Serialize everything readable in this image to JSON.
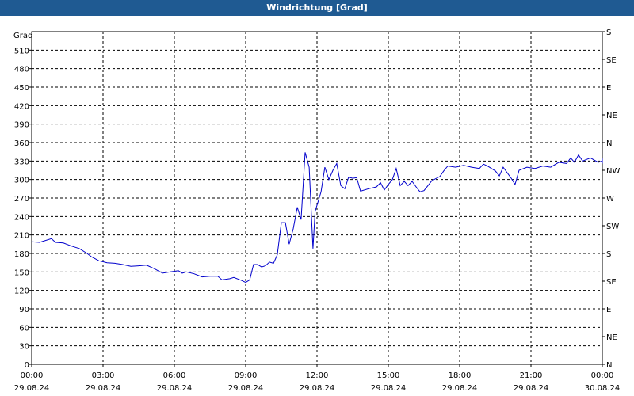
{
  "title": "Windrichtung [Grad]",
  "chart_data": {
    "type": "line",
    "title": "Windrichtung [Grad]",
    "ylabel": "Grad",
    "ylim": [
      0,
      540
    ],
    "xlim_hours": [
      0,
      24
    ],
    "yticks": [
      0,
      30,
      60,
      90,
      120,
      150,
      180,
      210,
      240,
      270,
      300,
      330,
      360,
      390,
      420,
      450,
      480,
      510
    ],
    "right_axis_labels": [
      {
        "y": 0,
        "label": "N"
      },
      {
        "y": 45,
        "label": "NE"
      },
      {
        "y": 90,
        "label": "E"
      },
      {
        "y": 135,
        "label": "SE"
      },
      {
        "y": 180,
        "label": "S"
      },
      {
        "y": 225,
        "label": "SW"
      },
      {
        "y": 270,
        "label": "W"
      },
      {
        "y": 315,
        "label": "NW"
      },
      {
        "y": 360,
        "label": "N"
      },
      {
        "y": 405,
        "label": "NE"
      },
      {
        "y": 450,
        "label": "E"
      },
      {
        "y": 495,
        "label": "SE"
      },
      {
        "y": 540,
        "label": "S"
      }
    ],
    "xticks": [
      {
        "h": 0,
        "time": "00:00",
        "date": "29.08.24"
      },
      {
        "h": 3,
        "time": "03:00",
        "date": "29.08.24"
      },
      {
        "h": 6,
        "time": "06:00",
        "date": "29.08.24"
      },
      {
        "h": 9,
        "time": "09:00",
        "date": "29.08.24"
      },
      {
        "h": 12,
        "time": "12:00",
        "date": "29.08.24"
      },
      {
        "h": 15,
        "time": "15:00",
        "date": "29.08.24"
      },
      {
        "h": 18,
        "time": "18:00",
        "date": "29.08.24"
      },
      {
        "h": 21,
        "time": "21:00",
        "date": "29.08.24"
      },
      {
        "h": 24,
        "time": "00:00",
        "date": "30.08.24"
      }
    ],
    "grid": true,
    "series": [
      {
        "color": "#0000cc",
        "points": [
          [
            0.0,
            199
          ],
          [
            0.33,
            198
          ],
          [
            0.5,
            200
          ],
          [
            0.83,
            204
          ],
          [
            1.0,
            198
          ],
          [
            1.33,
            197
          ],
          [
            1.67,
            192
          ],
          [
            2.0,
            188
          ],
          [
            2.33,
            180
          ],
          [
            2.5,
            175
          ],
          [
            2.83,
            168
          ],
          [
            3.17,
            165
          ],
          [
            3.5,
            164
          ],
          [
            3.83,
            162
          ],
          [
            4.17,
            159
          ],
          [
            4.5,
            160
          ],
          [
            4.83,
            161
          ],
          [
            5.17,
            155
          ],
          [
            5.5,
            148
          ],
          [
            5.83,
            150
          ],
          [
            6.17,
            152
          ],
          [
            6.33,
            148
          ],
          [
            6.5,
            150
          ],
          [
            6.83,
            147
          ],
          [
            7.17,
            142
          ],
          [
            7.5,
            143
          ],
          [
            7.83,
            143
          ],
          [
            8.0,
            137
          ],
          [
            8.33,
            139
          ],
          [
            8.5,
            141
          ],
          [
            8.83,
            136
          ],
          [
            9.0,
            133
          ],
          [
            9.17,
            137
          ],
          [
            9.33,
            162
          ],
          [
            9.5,
            162
          ],
          [
            9.67,
            158
          ],
          [
            9.83,
            160
          ],
          [
            10.0,
            166
          ],
          [
            10.17,
            164
          ],
          [
            10.33,
            178
          ],
          [
            10.5,
            230
          ],
          [
            10.67,
            230
          ],
          [
            10.83,
            195
          ],
          [
            11.0,
            220
          ],
          [
            11.17,
            255
          ],
          [
            11.33,
            235
          ],
          [
            11.5,
            344
          ],
          [
            11.67,
            320
          ],
          [
            11.83,
            188
          ],
          [
            11.92,
            248
          ],
          [
            12.17,
            280
          ],
          [
            12.33,
            320
          ],
          [
            12.5,
            300
          ],
          [
            12.67,
            315
          ],
          [
            12.83,
            326
          ],
          [
            13.0,
            290
          ],
          [
            13.17,
            285
          ],
          [
            13.33,
            304
          ],
          [
            13.5,
            302
          ],
          [
            13.67,
            303
          ],
          [
            13.83,
            281
          ],
          [
            14.17,
            285
          ],
          [
            14.5,
            288
          ],
          [
            14.67,
            295
          ],
          [
            14.83,
            283
          ],
          [
            15.0,
            292
          ],
          [
            15.17,
            300
          ],
          [
            15.33,
            318
          ],
          [
            15.5,
            290
          ],
          [
            15.67,
            297
          ],
          [
            15.83,
            290
          ],
          [
            16.0,
            297
          ],
          [
            16.17,
            288
          ],
          [
            16.33,
            280
          ],
          [
            16.5,
            282
          ],
          [
            16.83,
            298
          ],
          [
            17.17,
            305
          ],
          [
            17.33,
            314
          ],
          [
            17.5,
            322
          ],
          [
            17.83,
            320
          ],
          [
            18.17,
            323
          ],
          [
            18.5,
            320
          ],
          [
            18.83,
            318
          ],
          [
            19.0,
            325
          ],
          [
            19.17,
            322
          ],
          [
            19.5,
            314
          ],
          [
            19.67,
            306
          ],
          [
            19.83,
            320
          ],
          [
            20.17,
            302
          ],
          [
            20.33,
            292
          ],
          [
            20.5,
            315
          ],
          [
            20.83,
            320
          ],
          [
            21.17,
            318
          ],
          [
            21.5,
            322
          ],
          [
            21.83,
            320
          ],
          [
            22.17,
            328
          ],
          [
            22.5,
            326
          ],
          [
            22.67,
            335
          ],
          [
            22.83,
            328
          ],
          [
            23.0,
            340
          ],
          [
            23.17,
            330
          ],
          [
            23.5,
            335
          ],
          [
            23.83,
            328
          ],
          [
            24.17,
            330
          ],
          [
            24.5,
            326
          ],
          [
            24.83,
            334
          ],
          [
            24.9,
            332
          ]
        ]
      }
    ]
  }
}
